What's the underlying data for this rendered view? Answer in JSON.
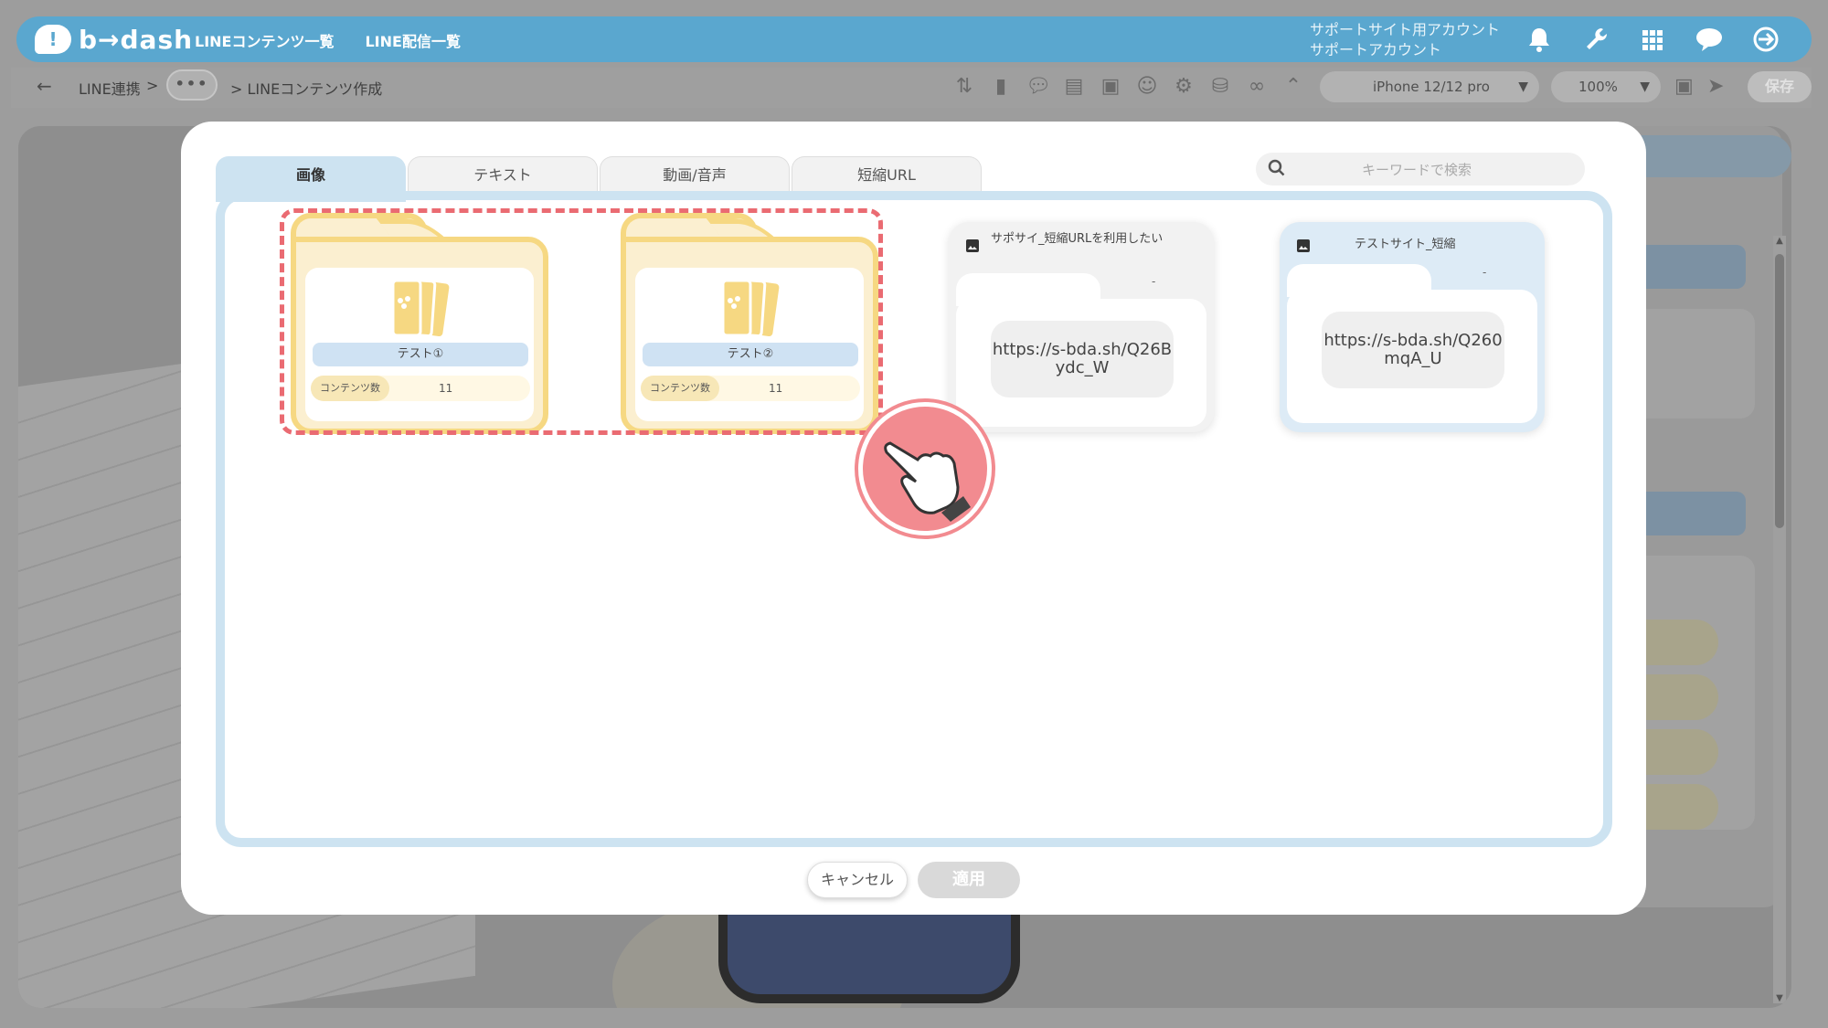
{
  "header": {
    "brand": "b→dash",
    "nav": [
      "LINEコンテンツ一覧",
      "LINE配信一覧"
    ],
    "account_line1": "サポートサイト用アカウント",
    "account_line2": "サポートアカウント",
    "icons": [
      "bell-icon",
      "wrench-icon",
      "grid-icon",
      "chat-icon",
      "logout-icon"
    ]
  },
  "toolbar": {
    "breadcrumb_first": "LINE連携",
    "breadcrumb_sep": ">",
    "breadcrumb_more": "•••",
    "breadcrumb_current": "> LINEコンテンツ作成",
    "device": "iPhone 12/12 pro",
    "zoom": "100%",
    "save_label": "保存"
  },
  "modal": {
    "tabs": [
      {
        "label": "画像",
        "active": true
      },
      {
        "label": "テキスト",
        "active": false
      },
      {
        "label": "動画/音声",
        "active": false
      },
      {
        "label": "短縮URL",
        "active": false
      }
    ],
    "search_placeholder": "キーワードで検索",
    "folders": [
      {
        "name": "テスト①",
        "count_label": "コンテンツ数",
        "count": "11"
      },
      {
        "name": "テスト②",
        "count_label": "コンテンツ数",
        "count": "11"
      }
    ],
    "url_cards": [
      {
        "title": "サポサイ_短縮URLを利用したい",
        "dash": "-",
        "url": "https://s-bda.sh/Q26Bydc_W"
      },
      {
        "title": "テストサイト_短縮",
        "dash": "-",
        "url": "https://s-bda.sh/Q260mqA_U"
      }
    ],
    "cancel_label": "キャンセル",
    "apply_label": "適用"
  },
  "colors": {
    "header_blue": "#5aa7cf",
    "tab_active": "#cde3f1",
    "folder_border": "#f6d882",
    "highlight_dash": "#ea6b72",
    "pointer_fill": "#f28b90"
  }
}
